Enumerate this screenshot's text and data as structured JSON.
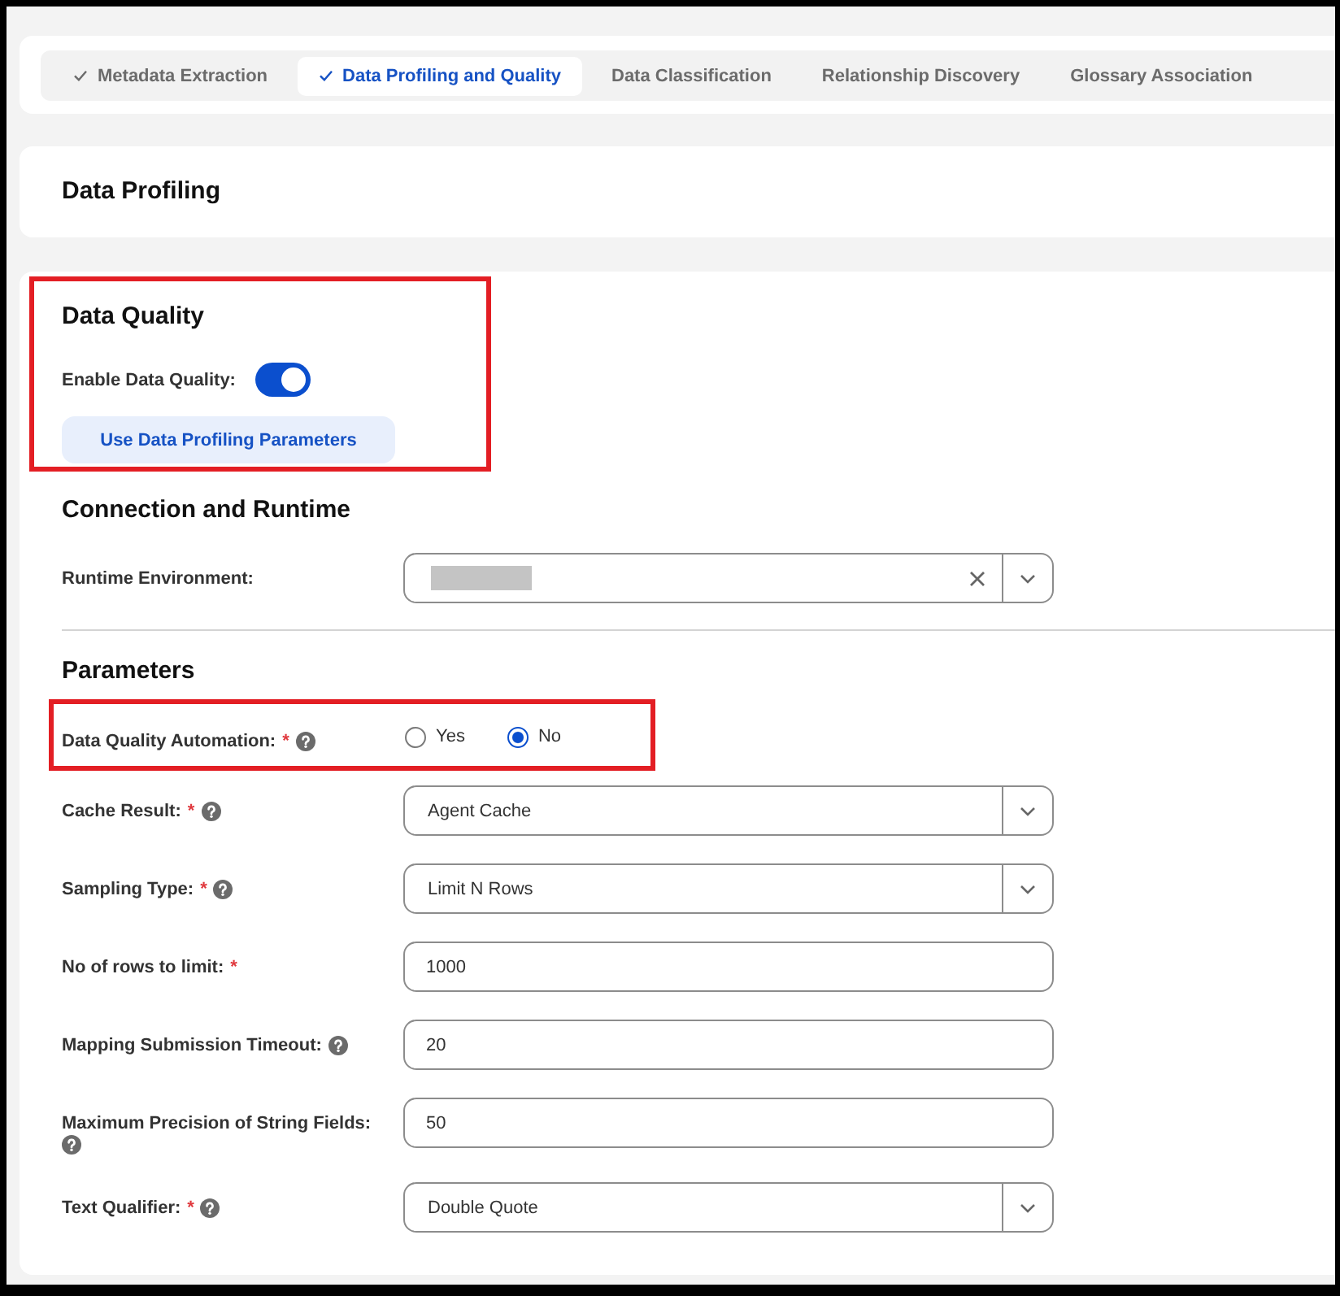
{
  "tabs": [
    {
      "label": "Metadata Extraction",
      "completed": true,
      "selected": false
    },
    {
      "label": "Data Profiling and Quality",
      "completed": true,
      "selected": true
    },
    {
      "label": "Data Classification",
      "completed": false,
      "selected": false
    },
    {
      "label": "Relationship Discovery",
      "completed": false,
      "selected": false
    },
    {
      "label": "Glossary Association",
      "completed": false,
      "selected": false
    }
  ],
  "profiling": {
    "title": "Data Profiling"
  },
  "data_quality": {
    "title": "Data Quality",
    "highlighted": true,
    "toggle": {
      "label": "Enable Data Quality:",
      "on": true
    },
    "button": "Use Data Profiling Parameters"
  },
  "connection": {
    "title": "Connection and Runtime",
    "fields": [
      {
        "label": "Runtime Environment:",
        "kind": "select",
        "help": false,
        "highlighted": false,
        "value_redacted": true,
        "clearable": true
      }
    ]
  },
  "parameters": {
    "title": "Parameters",
    "fields": [
      {
        "label": "Data Quality Automation:",
        "required_mark": "*",
        "help": true,
        "highlighted": true,
        "kind": "radio",
        "options": [
          {
            "label": "Yes",
            "selected": false
          },
          {
            "label": "No",
            "selected": true
          }
        ]
      },
      {
        "label": "Cache Result:",
        "required_mark": "*",
        "help": true,
        "highlighted": false,
        "kind": "select",
        "value": "Agent Cache"
      },
      {
        "label": "Sampling Type:",
        "required_mark": "*",
        "help": true,
        "highlighted": false,
        "kind": "select",
        "value": "Limit N Rows"
      },
      {
        "label": "No of rows to limit:",
        "required_mark": "*",
        "help": false,
        "highlighted": false,
        "kind": "text",
        "value": "1000"
      },
      {
        "label": "Mapping Submission Timeout:",
        "help": true,
        "highlighted": false,
        "kind": "text",
        "value": "20"
      },
      {
        "label": "Maximum Precision of String Fields:",
        "help": true,
        "highlighted": false,
        "kind": "text",
        "value": "50"
      },
      {
        "label": "Text Qualifier:",
        "required_mark": "*",
        "help": true,
        "highlighted": false,
        "kind": "select",
        "value": "Double Quote"
      }
    ]
  }
}
